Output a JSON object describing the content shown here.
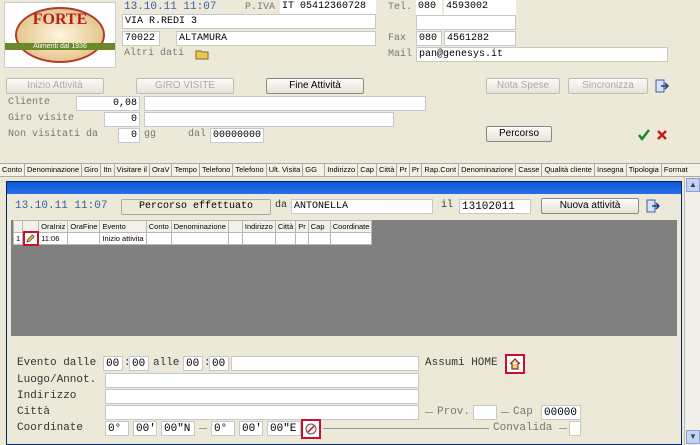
{
  "header": {
    "logo_text": "FORTE",
    "logo_sub": "Alimenti dal 1936",
    "datetime": "13.10.11 11:07",
    "piva_label": "P.IVA",
    "country": "IT",
    "piva": "05412360728",
    "address": "VIA R.REDI 3",
    "cap": "70022",
    "city": "ALTAMURA",
    "altri_dati": "Altri dati",
    "tel_label": "Tel.",
    "tel_prefix": "080",
    "tel_number": "4593002",
    "fax_label": "Fax",
    "fax_prefix": "080",
    "fax_number": "4561282",
    "mail_label": "Mail",
    "mail": "pan@genesys.it"
  },
  "toolbar": {
    "inizio": "Inizio Attività",
    "giro": "GIRO VISITE",
    "fine": "Fine  Attività",
    "nota": "Nota Spese",
    "sincronizza": "Sincronizza"
  },
  "filters": {
    "cliente_label": "Cliente",
    "cliente_value": "0,08",
    "giro_label": "Giro visite",
    "giro_value": "0",
    "nonvisit_label": "Non visitati da",
    "nonvisit_value": "0",
    "gg_label": "gg",
    "dal_label": "dal",
    "dal_value": "00000000",
    "percorso": "Percorso"
  },
  "columns": [
    "Conto",
    "Denominazione",
    "Giro",
    "Itn",
    "Visitare il",
    "OraV",
    "Tempo",
    "Telefono",
    "Telefono",
    "Ult. Visita",
    "GG",
    "Indirizzo",
    "Cap",
    "Città",
    "Pr",
    "Pr",
    "Rap.Cont",
    "Denominazione",
    "Casse",
    "Qualità cliente",
    "Insegna",
    "Tipologia",
    "Format"
  ],
  "panel": {
    "date": "13.10.11 11:07",
    "percorso_label": "Percorso effettuato",
    "da_label": "da",
    "agent": "ANTONELLA",
    "il_label": "il",
    "il_date": "13102011",
    "nuova": "Nuova attività",
    "grid_headers": [
      "",
      "",
      "OraIniz",
      "OraFine",
      "Evento",
      "Conto",
      "Denominazione",
      "",
      "Indirizzo",
      "Città",
      "Pr",
      "Cap",
      "Coordinate"
    ],
    "grid_row": [
      "1",
      "",
      "11:06",
      "",
      "Inizio attivita",
      "",
      "",
      "",
      "",
      "",
      "",
      "",
      ""
    ]
  },
  "detail": {
    "evento_label": "Evento dalle",
    "h1": "00",
    "m1": "00",
    "alle_label": "alle",
    "h2": "00",
    "m2": "00",
    "assumi": "Assumi HOME",
    "luogo_label": "Luogo/Annot.",
    "indirizzo_label": "Indirizzo",
    "citta_label": "Città",
    "prov_label": "Prov.",
    "cap_label": "Cap",
    "cap_value": "00000",
    "coord_label": "Coordinate",
    "c1": "0°",
    "c2": "00'",
    "c3": "00\"N",
    "c4": "0°",
    "c5": "00'",
    "c6": "00\"E",
    "convalida": "Convalida"
  }
}
